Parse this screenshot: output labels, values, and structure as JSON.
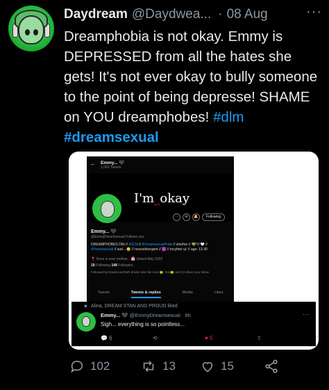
{
  "author": {
    "display_name": "Daydream",
    "handle": "@Daydwea...",
    "separator": "·",
    "date": "08 Aug",
    "more_label": "···"
  },
  "tweet": {
    "text_main": "Dreamphobia is not okay. Emmy is DEPRESSED from all the hates she gets! It's not ever okay to bully someone to the point of being depresse! SHAME on YOU dreamphobes!",
    "hashtag_1": "#dlm",
    "hashtag_2": "#dreamsexual"
  },
  "screenshot": {
    "back_arrow": "←",
    "header_name": "Emmy... 🖤",
    "header_tweets": "1,083 Tweets",
    "banner_text": "I'm",
    "banner_small": "not",
    "banner_text_2": "okay",
    "follow_label": "Following",
    "profile_name": "Emmy... 🖤",
    "profile_handle": "@EmmyDreamsexual  Follows you",
    "bio_1": "DREAMPHOBES DNI // ",
    "bio_tag_1": "#DLM",
    "bio_2": " // ",
    "bio_tag_2": "#DreamsexualPride",
    "bio_3": " // she/her // 💚🖤🤍 //",
    "bio_tag_3": "#Dreamsexual",
    "bio_4": " // sad... 😔 // neurodivergent // 🟪 // mcyttwt 🦋 // age: 13-30",
    "meta": "📍 Dove is ever mellow...   📅 Joined May 2022",
    "stats_following_num": "19",
    "stats_following": " Following   ",
    "stats_followers_num": "149",
    "stats_followers": " Followers",
    "followed_by": "Followed by DreamAndCNR dream stan fan love 🐸, Eve🐸 and 13 others you follow",
    "tabs": [
      "Tweets",
      "Tweets & replies",
      "Media",
      "Likes"
    ]
  },
  "liked_tweet": {
    "liked_by": "Alina, DREAM STAN AND PROUD liked",
    "name": "Emmy... 🖤",
    "handle_time": " @EmmyDreamsexual · 6h",
    "dots": "···",
    "text": "Sigh... everything is so pointless...",
    "reply_count": "💬  6",
    "retweet_icon": "⟲",
    "like_count": "♥  5",
    "share_icon": "⇧"
  },
  "actions": {
    "replies": "102",
    "retweets": "13",
    "likes": "15"
  }
}
